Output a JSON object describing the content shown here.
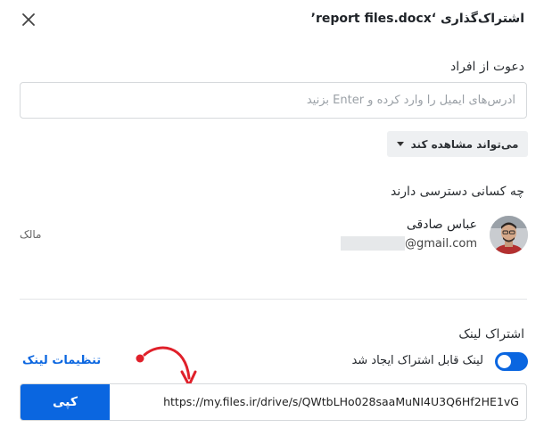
{
  "dialog": {
    "title": "اشتراک‌گذاری ‘report files.docx’"
  },
  "invite": {
    "label": "دعوت از افراد",
    "placeholder": "آدرس‌های ایمیل را وارد کرده و Enter بزنید",
    "value": "",
    "permission_label": "می‌تواند مشاهده کند"
  },
  "access": {
    "label": "چه کسانی دسترسی دارند",
    "user": {
      "name": "عباس صادقی",
      "email": "@gmail.com",
      "role": "مالک"
    }
  },
  "share_link": {
    "label": "اشتراک لینک",
    "toggle_label": "لینک قابل اشتراک ایجاد شد",
    "settings_label": "تنظیمات لینک",
    "url": "https://my.files.ir/drive/s/QWtbLHo028saaMuNI4U3Q6Hf2HE1vG",
    "copy_label": "کپی"
  },
  "colors": {
    "accent": "#0a66e0",
    "annotation_arrow": "#e0202a"
  },
  "icons": {
    "close": "close-icon",
    "dropdown": "caret-down-icon",
    "annotation": "curved-arrow-icon"
  }
}
